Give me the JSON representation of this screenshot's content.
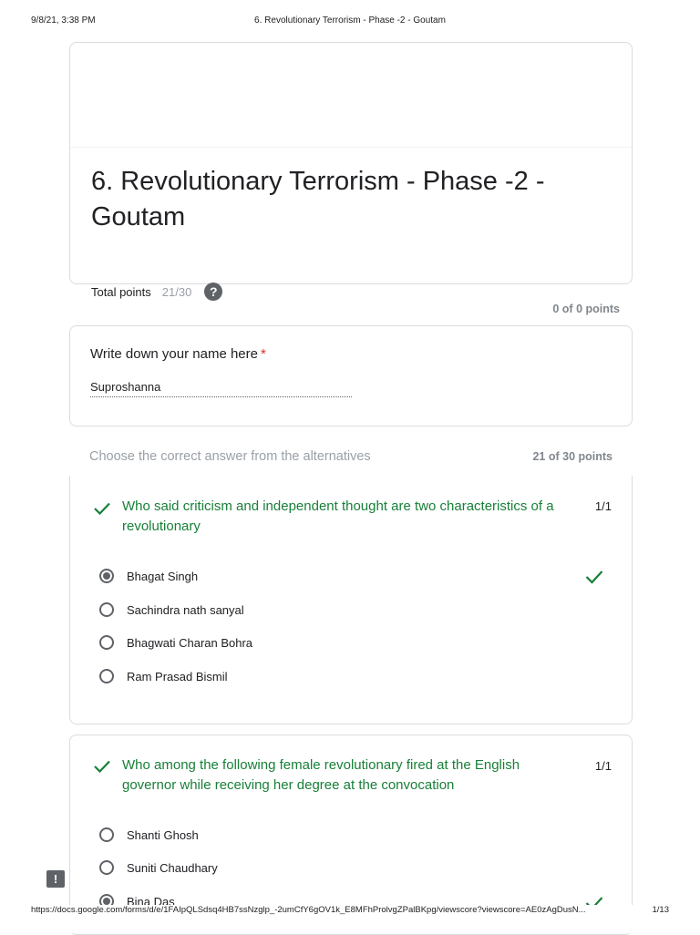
{
  "print": {
    "datetime": "9/8/21, 3:38 PM",
    "doc_title": "6. Revolutionary Terrorism - Phase -2 - Goutam",
    "url": "https://docs.google.com/forms/d/e/1FAIpQLSdsq4HB7ssNzglp_-2umCfY6gOV1k_E8MFhProlvgZPalBKpg/viewscore?viewscore=AE0zAgDusN...",
    "page": "1/13"
  },
  "header": {
    "title": "6. Revolutionary Terrorism - Phase -2 - Goutam",
    "total_label": "Total points",
    "total_value": "21/30",
    "help_glyph": "?"
  },
  "name_section": {
    "points": "0 of 0 points",
    "question": "Write down your name here",
    "required_mark": "*",
    "answer": "Suproshanna"
  },
  "quiz_section": {
    "description": "Choose the correct answer from the alternatives",
    "points": "21 of 30 points"
  },
  "questions": [
    {
      "text": "Who said criticism and independent thought are two characteristics of a revolutionary",
      "score": "1/1",
      "options": [
        "Bhagat Singh",
        "Sachindra nath sanyal",
        "Bhagwati Charan Bohra",
        "Ram Prasad Bismil"
      ],
      "selected": 0
    },
    {
      "text": "Who among the following female revolutionary fired at the English governor while receiving her degree at the convocation",
      "score": "1/1",
      "options": [
        "Shanti Ghosh",
        "Suniti Chaudhary",
        "Bina Das"
      ],
      "selected": 2
    }
  ],
  "colors": {
    "correct": "#188038",
    "muted": "#9aa0a6",
    "border": "#dadce0",
    "required": "#d93025"
  },
  "icons": {
    "correct": "checkmark-icon",
    "help": "help-circle-icon",
    "feedback": "feedback-icon"
  },
  "feedback_glyph": "!"
}
